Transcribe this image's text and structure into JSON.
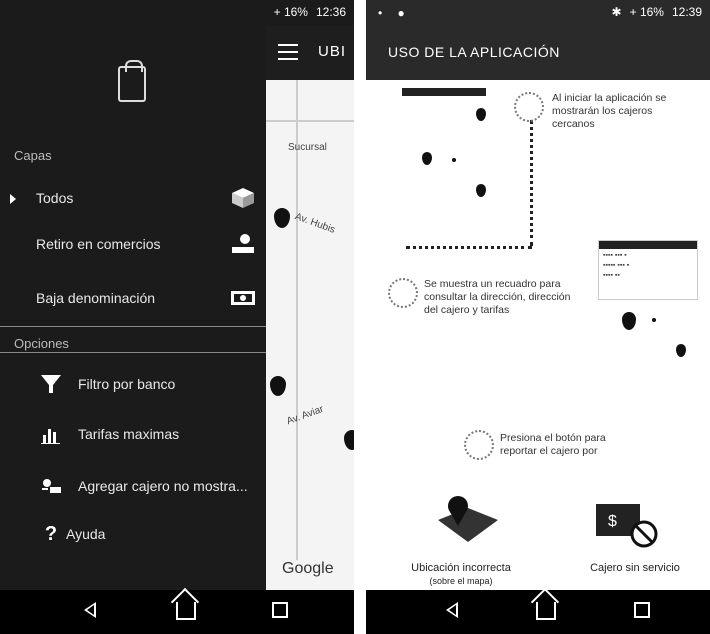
{
  "left_screen": {
    "statusbar": {
      "time": "12:36",
      "battery_label": "+ 16%"
    },
    "map_header_title": "UBI",
    "map_labels": [
      "Sucursal",
      "Av. Hubis",
      "Av. Aviar",
      "Google"
    ],
    "drawer": {
      "section_layers": "Capas",
      "layers": [
        {
          "label": "Todos",
          "icon": "cube-icon"
        },
        {
          "label": "Retiro en comercios",
          "icon": "hand-money-icon"
        },
        {
          "label": "Baja denominación",
          "icon": "banknote-icon"
        }
      ],
      "section_options": "Opciones",
      "options": [
        {
          "label": "Filtro por banco",
          "icon": "funnel-icon"
        },
        {
          "label": "Tarifas maximas",
          "icon": "bar-chart-icon"
        },
        {
          "label": "Agregar cajero no mostra...",
          "icon": "add-atm-icon"
        },
        {
          "label": "Ayuda",
          "icon": "question-icon"
        }
      ]
    }
  },
  "right_screen": {
    "statusbar": {
      "time": "12:39",
      "battery_label": "+ 16%"
    },
    "title": "USO DE LA APLICACIÓN",
    "hints": [
      "Al iniciar la aplicación se mostrarán los cajeros cercanos",
      "Se muestra un recuadro para consultar la dirección, dirección del cajero y tarifas",
      "Presiona el botón para reportar el cajero por"
    ],
    "bottom_actions": [
      {
        "label": "Ubicación incorrecta",
        "sublabel": "(sobre el mapa)",
        "icon": "map-pin-icon"
      },
      {
        "label": "Cajero sin servicio",
        "icon": "atm-blocked-icon"
      }
    ]
  },
  "colors": {
    "drawer_bg": "#1b1b1b",
    "appbar_bg": "#2a2a2a",
    "text_light": "#e8e8e8"
  }
}
